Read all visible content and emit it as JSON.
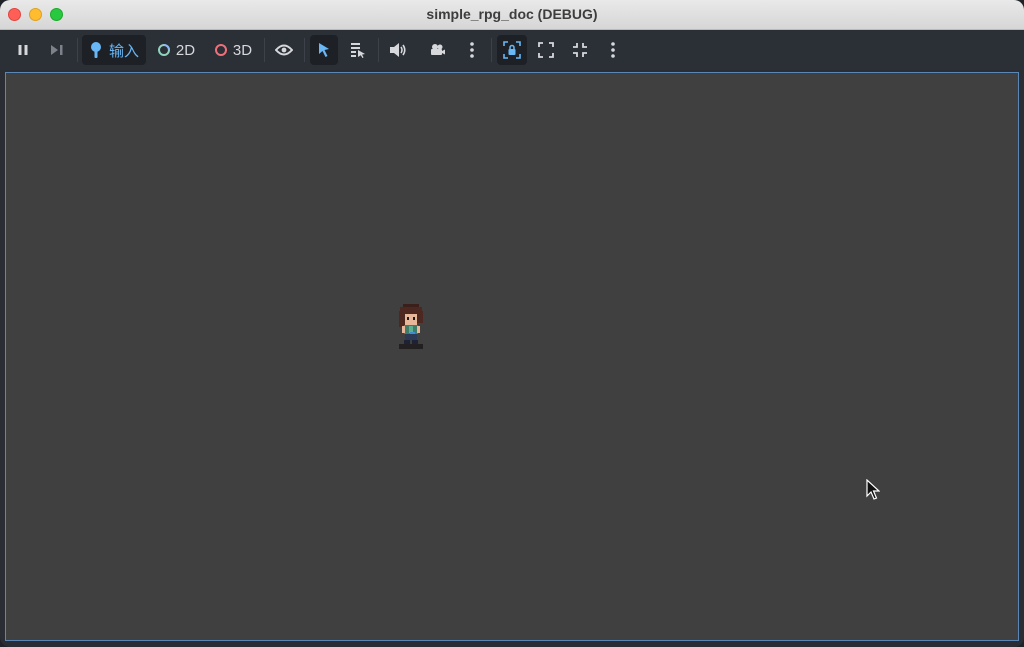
{
  "window": {
    "title": "simple_rpg_doc (DEBUG)"
  },
  "toolbar": {
    "input_label": "输入",
    "mode_2d_label": "2D",
    "mode_3d_label": "3D"
  },
  "colors": {
    "accent": "#6ab7f5",
    "viewport_bg": "#404040",
    "toolbar_bg": "#2b2f36",
    "viewport_border": "#5a87b6"
  },
  "icons": [
    "pause-icon",
    "step-frame-icon",
    "input-icon",
    "circle-2d-icon",
    "circle-3d-icon",
    "eye-icon",
    "select-pointer-icon",
    "list-select-icon",
    "speaker-icon",
    "camera-icon",
    "more-vertical-icon",
    "lock-frame-icon",
    "expand-icon",
    "collapse-icon",
    "more-vertical-icon"
  ]
}
